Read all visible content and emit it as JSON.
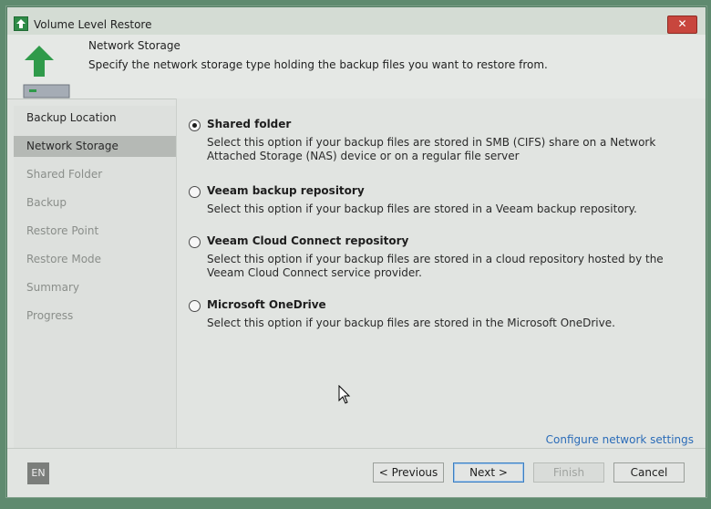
{
  "window": {
    "title": "Volume Level Restore",
    "close_label": "✕"
  },
  "header": {
    "title": "Network Storage",
    "description": "Specify the network storage type holding the backup files you want to restore from."
  },
  "sidebar": {
    "steps": [
      {
        "label": "Backup Location",
        "state": "done"
      },
      {
        "label": "Network Storage",
        "state": "active"
      },
      {
        "label": "Shared Folder",
        "state": "pending"
      },
      {
        "label": "Backup",
        "state": "pending"
      },
      {
        "label": "Restore Point",
        "state": "pending"
      },
      {
        "label": "Restore Mode",
        "state": "pending"
      },
      {
        "label": "Summary",
        "state": "pending"
      },
      {
        "label": "Progress",
        "state": "pending"
      }
    ]
  },
  "options": [
    {
      "label": "Shared folder",
      "checked": true,
      "description": "Select this option if your backup files are stored in SMB (CIFS) share on a Network Attached Storage (NAS) device or on a regular file server"
    },
    {
      "label": "Veeam backup repository",
      "checked": false,
      "description": "Select this option if your backup files are stored in a Veeam backup repository."
    },
    {
      "label": "Veeam Cloud Connect repository",
      "checked": false,
      "description": "Select this option if your backup files are stored in a cloud repository hosted by the Veeam Cloud Connect service provider."
    },
    {
      "label": "Microsoft OneDrive",
      "checked": false,
      "description": "Select this option if your backup files are stored in the Microsoft OneDrive."
    }
  ],
  "configure_link": "Configure network settings",
  "footer": {
    "language": "EN",
    "previous": "< Previous",
    "next": "Next >",
    "finish": "Finish",
    "cancel": "Cancel"
  },
  "colors": {
    "accent": "#2e8b47",
    "link": "#2b6cb8",
    "active_step": "#b5b9b5"
  }
}
